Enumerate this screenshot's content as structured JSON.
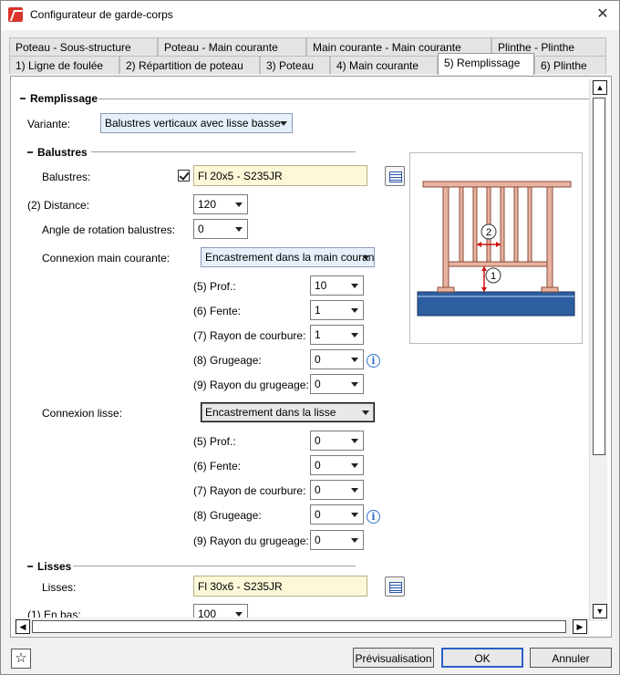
{
  "window": {
    "title": "Configurateur de garde-corps"
  },
  "tabs_row1": [
    "Poteau - Sous-structure",
    "Poteau - Main courante",
    "Main courante - Main courante",
    "Plinthe - Plinthe"
  ],
  "tabs_row2": [
    "1) Ligne de foulée",
    "2) Répartition de poteau",
    "3) Poteau",
    "4) Main courante",
    "5) Remplissage",
    "6) Plinthe"
  ],
  "section": {
    "title": "Remplissage"
  },
  "variante": {
    "label": "Variante:",
    "value": "Balustres verticaux avec lisse basse"
  },
  "balustres": {
    "group_title": "Balustres",
    "label": "Balustres:",
    "checked": true,
    "value": "Fl 20x5 - S235JR",
    "distance_label": "(2) Distance:",
    "distance_value": "120",
    "rotation_label": "Angle de rotation balustres:",
    "rotation_value": "0",
    "connexion_main_label": "Connexion main courante:",
    "connexion_main_value": "Encastrement dans la main courante",
    "main_params": [
      {
        "label": "(5) Prof.:",
        "value": "10"
      },
      {
        "label": "(6) Fente:",
        "value": "1"
      },
      {
        "label": "(7) Rayon de courbure:",
        "value": "1"
      },
      {
        "label": "(8) Grugeage:",
        "value": "0"
      },
      {
        "label": "(9) Rayon du grugeage:",
        "value": "0"
      }
    ],
    "connexion_lisse_label": "Connexion lisse:",
    "connexion_lisse_value": "Encastrement dans la lisse",
    "lisse_params": [
      {
        "label": "(5) Prof.:",
        "value": "0"
      },
      {
        "label": "(6) Fente:",
        "value": "0"
      },
      {
        "label": "(7) Rayon de courbure:",
        "value": "0"
      },
      {
        "label": "(8) Grugeage:",
        "value": "0"
      },
      {
        "label": "(9) Rayon du grugeage:",
        "value": "0"
      }
    ]
  },
  "lisses": {
    "group_title": "Lisses",
    "label": "Lisses:",
    "value": "Fl 30x6 - S235JR",
    "en_bas_label": "(1) En bas:",
    "en_bas_value": "100"
  },
  "preview": {
    "marker_1": "1",
    "marker_2": "2"
  },
  "info_glyph": "i",
  "buttons": {
    "preview": "Prévisualisation",
    "ok": "OK",
    "cancel": "Annuler"
  },
  "colors": {
    "railing": "#e8b3a0",
    "railing_stroke": "#8a4a38",
    "floor": "#2e5fa0",
    "dimension": "#d01010"
  }
}
